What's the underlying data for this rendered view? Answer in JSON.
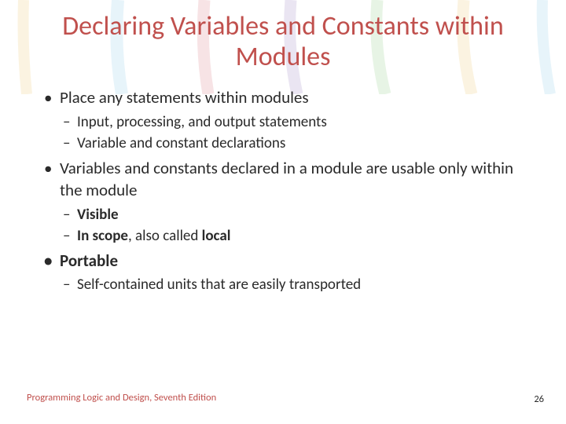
{
  "title": "Declaring Variables and Constants within Modules",
  "bullets": {
    "b1": "Place any statements within modules",
    "b1a": "Input, processing, and output statements",
    "b1b": "Variable and constant declarations",
    "b2": "Variables and constants declared in a module are usable only within the module",
    "b2a": "Visible",
    "b2b_bold": "In scope",
    "b2b_rest": ", also called ",
    "b2b_local": "local",
    "b3": "Portable",
    "b3a": "Self-contained units that are easily transported"
  },
  "footer": {
    "left": "Programming Logic and Design, Seventh Edition",
    "page": "26"
  }
}
